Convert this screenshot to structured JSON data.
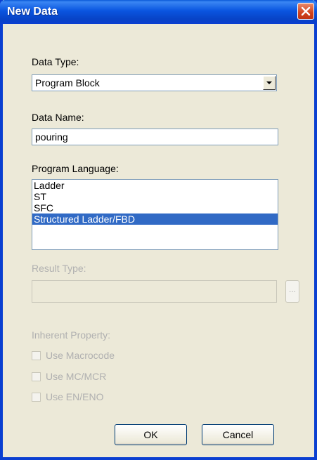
{
  "window": {
    "title": "New Data"
  },
  "data_type": {
    "label": "Data Type:",
    "value": "Program Block",
    "dropdown_icon": "chevron-down-icon"
  },
  "data_name": {
    "label": "Data Name:",
    "value": "pouring"
  },
  "program_language": {
    "label": "Program Language:",
    "options": [
      "Ladder",
      "ST",
      "SFC",
      "Structured Ladder/FBD"
    ],
    "selected_index": 3
  },
  "result_type": {
    "label": "Result Type:",
    "value": "",
    "browse_label": "..."
  },
  "inherent_property": {
    "label": "Inherent Property:",
    "options": [
      {
        "label": "Use Macrocode",
        "checked": false
      },
      {
        "label": "Use MC/MCR",
        "checked": false
      },
      {
        "label": "Use EN/ENO",
        "checked": false
      }
    ]
  },
  "buttons": {
    "ok": "OK",
    "cancel": "Cancel"
  },
  "colors": {
    "title_bar": "#0a55e0",
    "selection": "#316ac5",
    "dialog_bg": "#ece9d8",
    "close": "#d0421d"
  }
}
